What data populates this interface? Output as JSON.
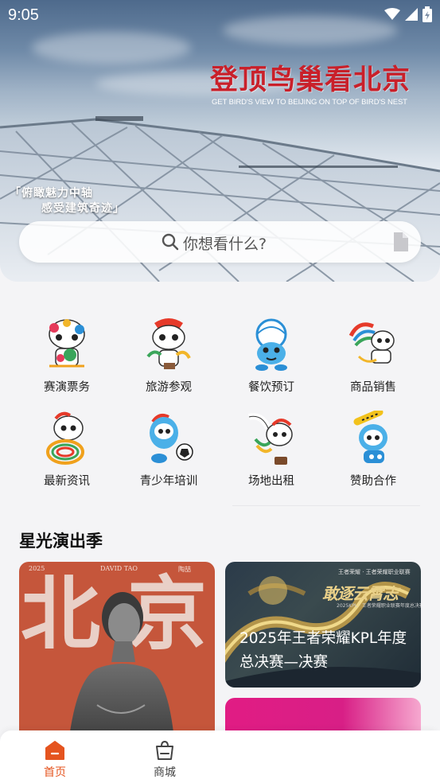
{
  "status_bar": {
    "time": "9:05"
  },
  "hero": {
    "title": "登顶鸟巢看北京",
    "subtitle": "GET BIRD'S VIEW TO BEIJING ON TOP OF BIRD'S NEST",
    "slogan_line1": "「俯瞰魅力中轴",
    "slogan_line2": "感受建筑奇迹」"
  },
  "search": {
    "placeholder": "你想看什么?"
  },
  "services": [
    {
      "label": "赛演票务",
      "icon": "mascot-tickets-icon"
    },
    {
      "label": "旅游参观",
      "icon": "mascot-tour-icon"
    },
    {
      "label": "餐饮预订",
      "icon": "mascot-dining-icon"
    },
    {
      "label": "商品销售",
      "icon": "mascot-goods-icon"
    },
    {
      "label": "最新资讯",
      "icon": "mascot-news-icon"
    },
    {
      "label": "青少年培训",
      "icon": "mascot-training-icon"
    },
    {
      "label": "场地出租",
      "icon": "mascot-venue-icon"
    },
    {
      "label": "赞助合作",
      "icon": "mascot-sponsor-icon"
    }
  ],
  "section": {
    "title": "星光演出季"
  },
  "cards": {
    "concert": {
      "year": "2025",
      "artist": "DAVID TAO",
      "artist_cn": "陶喆",
      "big1": "北",
      "big2": "京"
    },
    "kpl": {
      "logos": "王者荣耀 · 王者荣耀职业联赛",
      "brand": "敢逐云霄志",
      "brand_sub": "2025KPL · 王者荣耀职业联赛年度总决赛",
      "title": "2025年王者荣耀KPL年度总决赛—决赛"
    }
  },
  "bottom_nav": {
    "home": "首页",
    "shop": "商城"
  },
  "colors": {
    "accent": "#e5541f",
    "hero_title": "#c9202a"
  }
}
